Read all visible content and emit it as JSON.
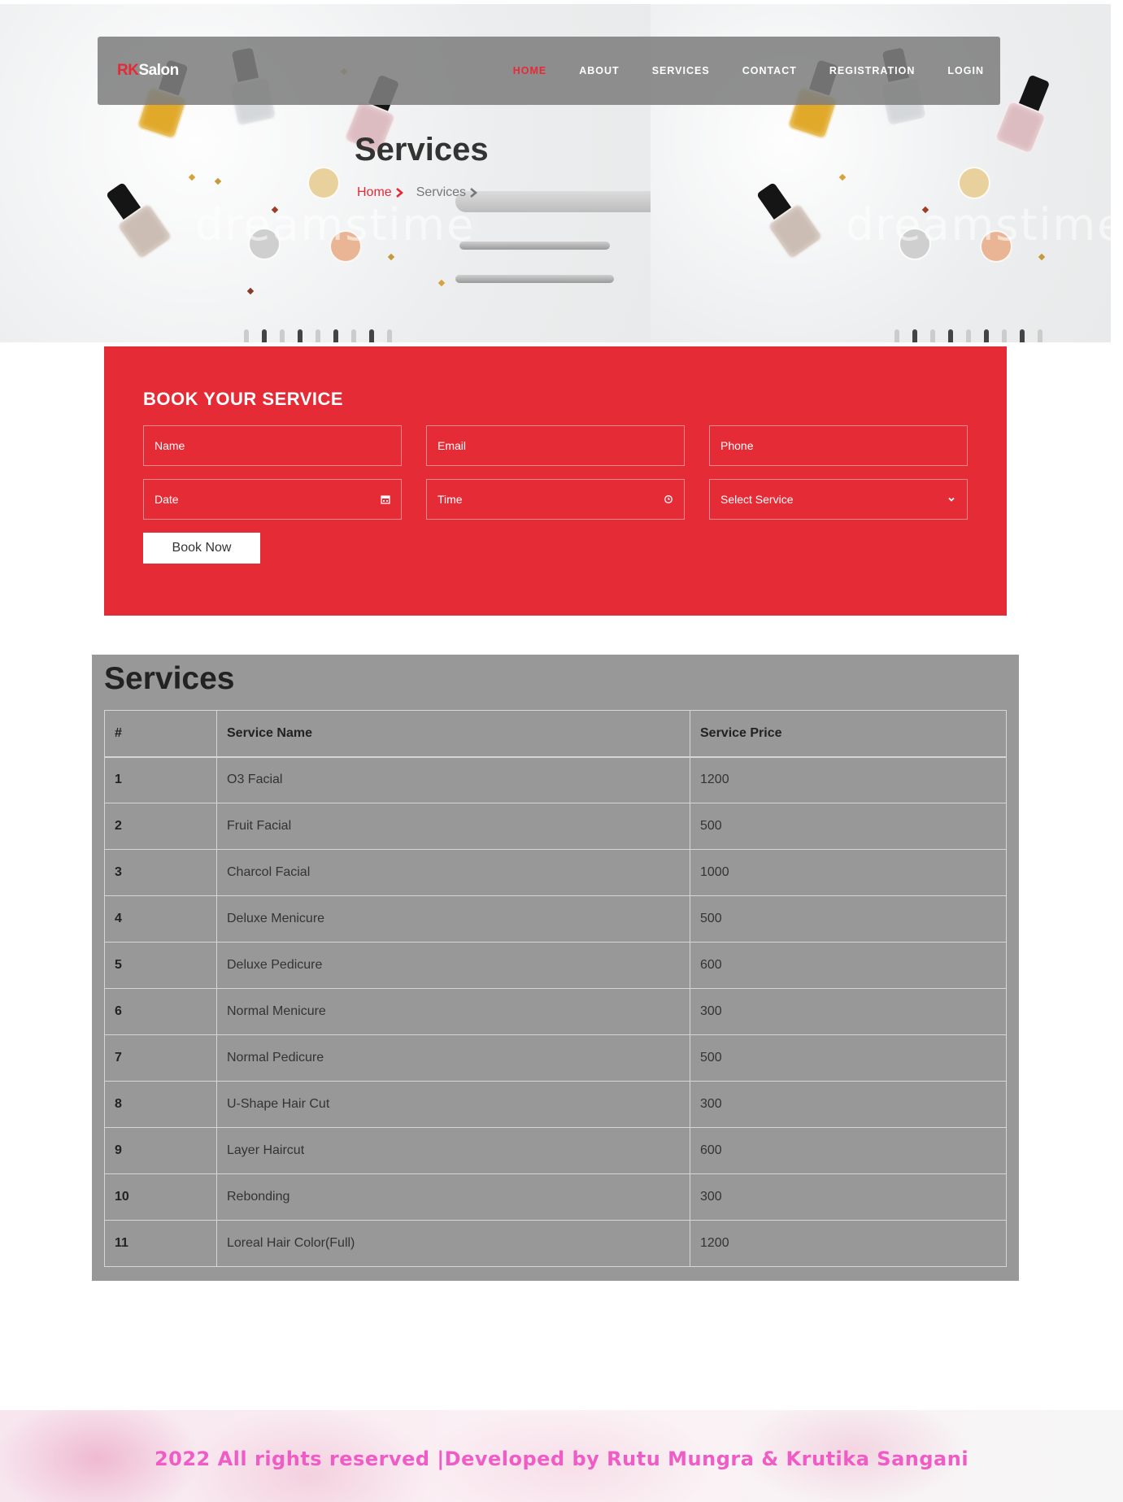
{
  "brand": {
    "part1": "RK",
    "part2": "Salon"
  },
  "nav": {
    "items": [
      {
        "label": "HOME",
        "active": true
      },
      {
        "label": "ABOUT",
        "active": false
      },
      {
        "label": "SERVICES",
        "active": false
      },
      {
        "label": "CONTACT",
        "active": false
      },
      {
        "label": "REGISTRATION",
        "active": false
      },
      {
        "label": "LOGIN",
        "active": false
      }
    ]
  },
  "hero": {
    "title": "Services",
    "breadcrumb": {
      "home": "Home",
      "current": "Services"
    },
    "watermark": "dreamstime"
  },
  "booking": {
    "title": "BOOK YOUR SERVICE",
    "fields": {
      "name": "Name",
      "email": "Email",
      "phone": "Phone",
      "date": "Date",
      "time": "Time",
      "service": "Select Service"
    },
    "submit": "Book Now"
  },
  "services": {
    "title": "Services",
    "headers": {
      "num": "#",
      "name": "Service Name",
      "price": "Service Price"
    },
    "rows": [
      {
        "num": "1",
        "name": "O3 Facial",
        "price": "1200"
      },
      {
        "num": "2",
        "name": "Fruit Facial",
        "price": "500"
      },
      {
        "num": "3",
        "name": "Charcol Facial",
        "price": "1000"
      },
      {
        "num": "4",
        "name": "Deluxe Menicure",
        "price": "500"
      },
      {
        "num": "5",
        "name": "Deluxe Pedicure",
        "price": "600"
      },
      {
        "num": "6",
        "name": "Normal Menicure",
        "price": "300"
      },
      {
        "num": "7",
        "name": "Normal Pedicure",
        "price": "500"
      },
      {
        "num": "8",
        "name": "U-Shape Hair Cut",
        "price": "300"
      },
      {
        "num": "9",
        "name": "Layer Haircut",
        "price": "600"
      },
      {
        "num": "10",
        "name": "Rebonding",
        "price": "300"
      },
      {
        "num": "11",
        "name": "Loreal Hair Color(Full)",
        "price": "1200"
      }
    ]
  },
  "footer": {
    "text": "2022 All rights reserved |Developed by Rutu Mungra & Krutika Sangani"
  },
  "colors": {
    "accent": "#e62a35",
    "booking_bg": "#e52b35",
    "table_bg": "#989898",
    "footer_text": "#f05cc6"
  }
}
